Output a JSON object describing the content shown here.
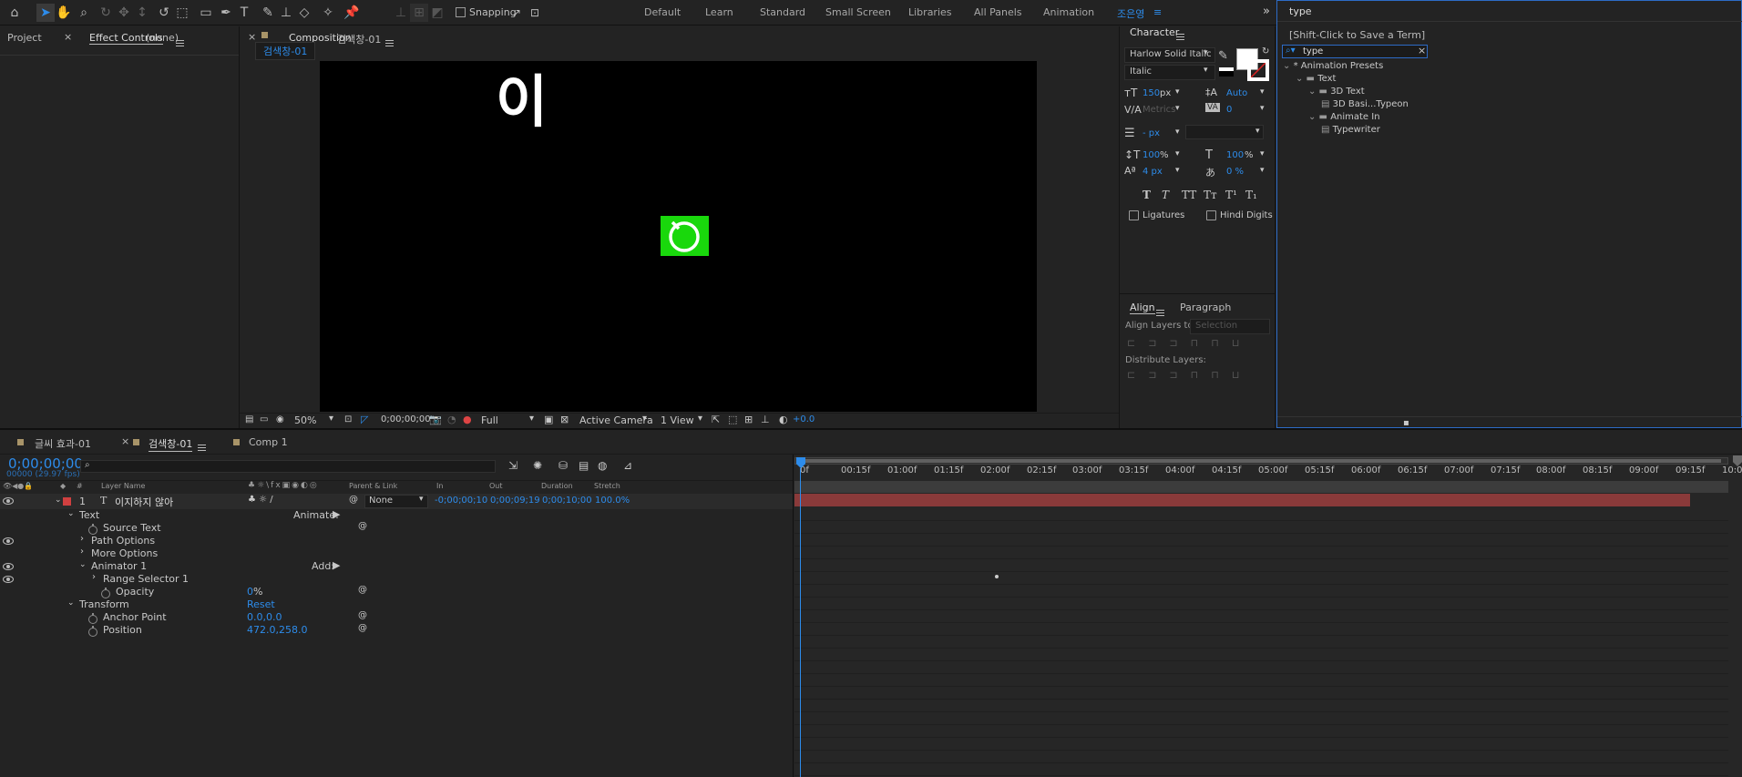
{
  "workspaces": [
    "Default",
    "Learn",
    "Standard",
    "Small Screen",
    "Libraries",
    "All Panels",
    "Animation",
    "조은영"
  ],
  "toolbar": {
    "snapping_label": "Snapping"
  },
  "left_panel": {
    "tab_project": "Project",
    "tab_effect_controls": "Effect Controls",
    "effect_target": "(none)"
  },
  "comp_panel": {
    "tab_prefix": "Composition",
    "comp_name": "검색창-01",
    "subtab": "검색창-01",
    "canvas_text": "이",
    "zoom": "50%",
    "timecode": "0;00;00;00",
    "resolution": "Full",
    "camera": "Active Camera",
    "views": "1 View",
    "exposure": "+0.0",
    "logo_color": "#19d80c"
  },
  "character": {
    "title": "Character",
    "font": "Harlow Solid Italic",
    "style": "Italic",
    "size": "150",
    "size_unit": "px",
    "leading": "Auto",
    "kerning": "Metrics",
    "tracking": "0",
    "stroke": "- px",
    "vscale": "100",
    "hscale": "100",
    "baseline": "4 px",
    "tsume": "0 %",
    "pct": "%",
    "ligatures": "Ligatures",
    "hindi_digits": "Hindi Digits"
  },
  "align": {
    "tab_align": "Align",
    "tab_paragraph": "Paragraph",
    "align_to": "Align Layers to:",
    "align_to_value": "Selection",
    "distribute": "Distribute Layers:"
  },
  "effects": {
    "search_title": "type",
    "hint": "[Shift-Click to Save a Term]",
    "search_value": "type",
    "tree": [
      {
        "label": "* Animation Presets",
        "indent": 0,
        "folder": false
      },
      {
        "label": "Text",
        "indent": 1,
        "folder": true
      },
      {
        "label": "3D Text",
        "indent": 2,
        "folder": true
      },
      {
        "label": "3D Basi...Typeon",
        "indent": 3,
        "folder": false
      },
      {
        "label": "Animate In",
        "indent": 2,
        "folder": true
      },
      {
        "label": "Typewriter",
        "indent": 3,
        "folder": false
      }
    ]
  },
  "timeline": {
    "tabs": [
      "글씨 효과-01",
      "검색창-01",
      "Comp 1"
    ],
    "timecode": "0;00;00;00",
    "frames": "00000 (29.97 fps)",
    "search_placeholder": "",
    "col_hash": "#",
    "col_layer_name": "Layer Name",
    "col_parent": "Parent & Link",
    "col_in": "In",
    "col_out": "Out",
    "col_duration": "Duration",
    "col_stretch": "Stretch",
    "layer": {
      "num": "1",
      "name": "이지하지 않아",
      "parent": "None",
      "in": "-0;00;00;10",
      "out": "0;00;09;19",
      "duration": "0;00;10;00",
      "stretch": "100.0%"
    },
    "text_group": "Text",
    "animate_label": "Animate:",
    "source_text": "Source Text",
    "path_options": "Path Options",
    "more_options": "More Options",
    "animator": "Animator 1",
    "add_label": "Add:",
    "range_selector": "Range Selector 1",
    "opacity": "Opacity",
    "opacity_val": "0",
    "opacity_unit": "%",
    "transform": "Transform",
    "reset": "Reset",
    "anchor_point": "Anchor Point",
    "anchor_val": "0.0,0.0",
    "position": "Position",
    "position_val": "472.0,258.0",
    "ruler": [
      "0f",
      "00:15f",
      "01:00f",
      "01:15f",
      "02:00f",
      "02:15f",
      "03:00f",
      "03:15f",
      "04:00f",
      "04:15f",
      "05:00f",
      "05:15f",
      "06:00f",
      "06:15f",
      "07:00f",
      "07:15f",
      "08:00f",
      "08:15f",
      "09:00f",
      "09:15f",
      "10:0"
    ],
    "layer_bar_color": "#8a3a3a",
    "label_color": "#d04040"
  }
}
